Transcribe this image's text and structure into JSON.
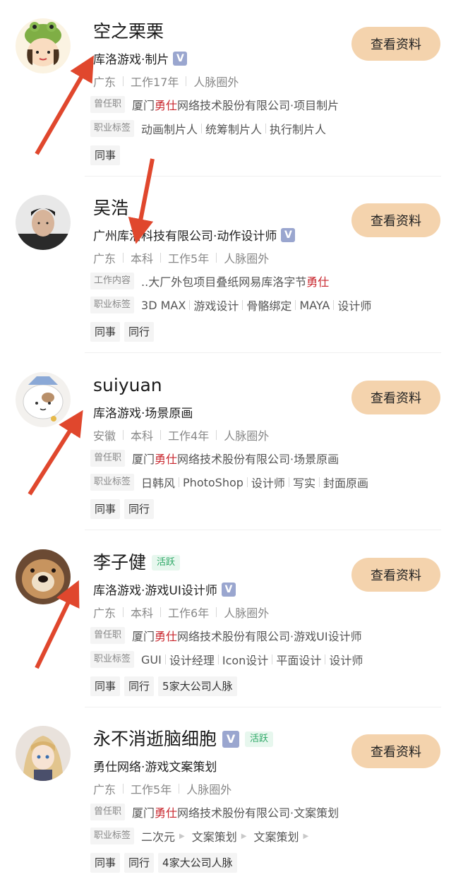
{
  "view_button_label": "查看资料",
  "colors": {
    "accent_button": "#f4d3ad",
    "highlight_red": "#c8252c",
    "active_green": "#2da866",
    "arrow_red": "#e0472d"
  },
  "cards": [
    {
      "name": "空之栗栗",
      "active": "",
      "title": "库洛游戏·制片",
      "meta": [
        "广东",
        "工作17年",
        "人脉圈外"
      ],
      "info": {
        "label": "曾任职",
        "pre": "厦门",
        "hl": "勇仕",
        "post": "网络技术股份有限公司·项目制片"
      },
      "tags_label": "职业标签",
      "tags": [
        "动画制片人",
        "统筹制片人",
        "执行制片人"
      ],
      "chips": [
        "同事"
      ]
    },
    {
      "name": "吴浩",
      "active": "",
      "title": "广州库洛科技有限公司·动作设计师",
      "meta": [
        "广东",
        "本科",
        "工作5年",
        "人脉圈外"
      ],
      "info": {
        "label": "工作内容",
        "pre": "..大厂外包项目叠纸网易库洛字节",
        "hl": "勇仕",
        "post": ""
      },
      "tags_label": "职业标签",
      "tags": [
        "3D MAX",
        "游戏设计",
        "骨骼绑定",
        "MAYA",
        "设计师"
      ],
      "chips": [
        "同事",
        "同行"
      ]
    },
    {
      "name": "suiyuan",
      "active": "",
      "title": "库洛游戏·场景原画",
      "meta": [
        "安徽",
        "本科",
        "工作4年",
        "人脉圈外"
      ],
      "info": {
        "label": "曾任职",
        "pre": "厦门",
        "hl": "勇仕",
        "post": "网络技术股份有限公司·场景原画"
      },
      "tags_label": "职业标签",
      "tags": [
        "日韩风",
        "PhotoShop",
        "设计师",
        "写实",
        "封面原画"
      ],
      "chips": [
        "同事",
        "同行"
      ]
    },
    {
      "name": "李子健",
      "active": "活跃",
      "title": "库洛游戏·游戏UI设计师",
      "meta": [
        "广东",
        "本科",
        "工作6年",
        "人脉圈外"
      ],
      "info": {
        "label": "曾任职",
        "pre": "厦门",
        "hl": "勇仕",
        "post": "网络技术股份有限公司·游戏UI设计师"
      },
      "tags_label": "职业标签",
      "tags": [
        "GUI",
        "设计经理",
        "Icon设计",
        "平面设计",
        "设计师"
      ],
      "chips": [
        "同事",
        "同行",
        "5家大公司人脉"
      ]
    },
    {
      "name": "永不消逝脑细胞",
      "active": "活跃",
      "title": "勇仕网络·游戏文案策划",
      "meta": [
        "广东",
        "工作5年",
        "人脉圈外"
      ],
      "info": {
        "label": "曾任职",
        "pre": "厦门",
        "hl": "勇仕",
        "post": "网络技术股份有限公司·文案策划"
      },
      "tags_label": "职业标签",
      "tags": [
        "二次元",
        "文案策划",
        "文案策划"
      ],
      "chips": [
        "同事",
        "同行",
        "4家大公司人脉"
      ]
    }
  ]
}
